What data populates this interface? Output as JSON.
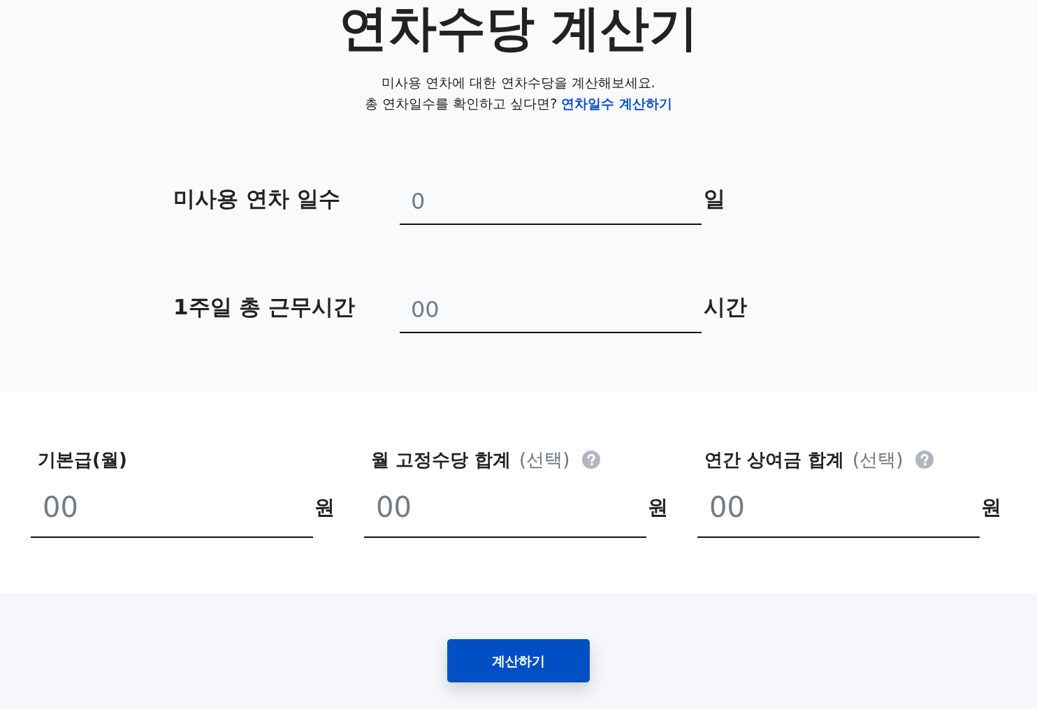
{
  "title": "연차수당 계산기",
  "intro": {
    "text": "미사용 연차에 대한 연차수당을 계산해보세요.",
    "prompt": "총 연차일수를 확인하고 싶다면?",
    "link": "연차일수 계산하기"
  },
  "top_fields": [
    {
      "label": "미사용 연차 일수",
      "placeholder": "0",
      "unit": "일"
    },
    {
      "label": "1주일 총 근무시간",
      "placeholder": "00",
      "unit": "시간"
    }
  ],
  "pay_fields": [
    {
      "label": "기본급(월)",
      "help": false,
      "placeholder": "00",
      "unit": "원"
    },
    {
      "label": "월 고정수당 합계",
      "optional": "(선택)",
      "help": true,
      "placeholder": "00",
      "unit": "원"
    },
    {
      "label": "연간 상여금 합계",
      "optional": "(선택)",
      "help": true,
      "placeholder": "00",
      "unit": "원"
    }
  ],
  "button": "계산하기"
}
